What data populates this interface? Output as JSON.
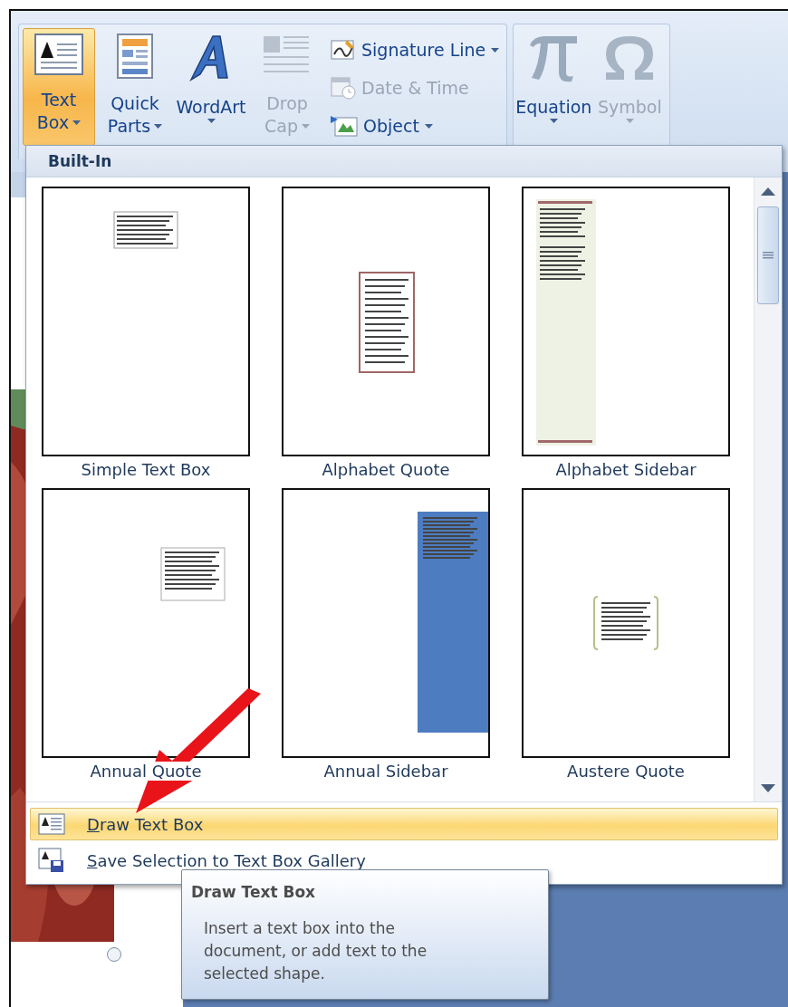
{
  "ribbon": {
    "groups": [
      {
        "large_buttons": [
          {
            "label_lines": [
              "Text",
              "Box"
            ],
            "dropdown": true,
            "selected": true,
            "disabled": false
          },
          {
            "label_lines": [
              "Quick",
              "Parts"
            ],
            "dropdown": true,
            "selected": false,
            "disabled": false
          },
          {
            "label_lines": [
              "WordArt"
            ],
            "dropdown": true,
            "selected": false,
            "disabled": false
          },
          {
            "label_lines": [
              "Drop",
              "Cap"
            ],
            "dropdown": true,
            "selected": false,
            "disabled": true
          }
        ],
        "small_buttons": [
          {
            "label": "Signature Line",
            "dropdown": true,
            "disabled": false
          },
          {
            "label": "Date & Time",
            "dropdown": false,
            "disabled": true
          },
          {
            "label": "Object",
            "dropdown": true,
            "disabled": false
          }
        ]
      },
      {
        "large_buttons": [
          {
            "label_lines": [
              "Equation"
            ],
            "dropdown": true,
            "selected": false,
            "disabled": false
          },
          {
            "label_lines": [
              "Symbol"
            ],
            "dropdown": true,
            "selected": false,
            "disabled": true
          }
        ]
      }
    ]
  },
  "gallery": {
    "header": "Built-In",
    "items": [
      {
        "label": "Simple Text Box"
      },
      {
        "label": "Alphabet Quote"
      },
      {
        "label": "Alphabet Sidebar"
      },
      {
        "label": "Annual Quote"
      },
      {
        "label": "Annual Sidebar"
      },
      {
        "label": "Austere Quote"
      }
    ],
    "menu": [
      {
        "label": "Draw Text Box",
        "selected": true
      },
      {
        "label": "Save Selection to Text Box Gallery",
        "selected": false
      }
    ]
  },
  "tooltip": {
    "title": "Draw Text Box",
    "body": "Insert a text box into the document, or add text to the selected shape."
  }
}
